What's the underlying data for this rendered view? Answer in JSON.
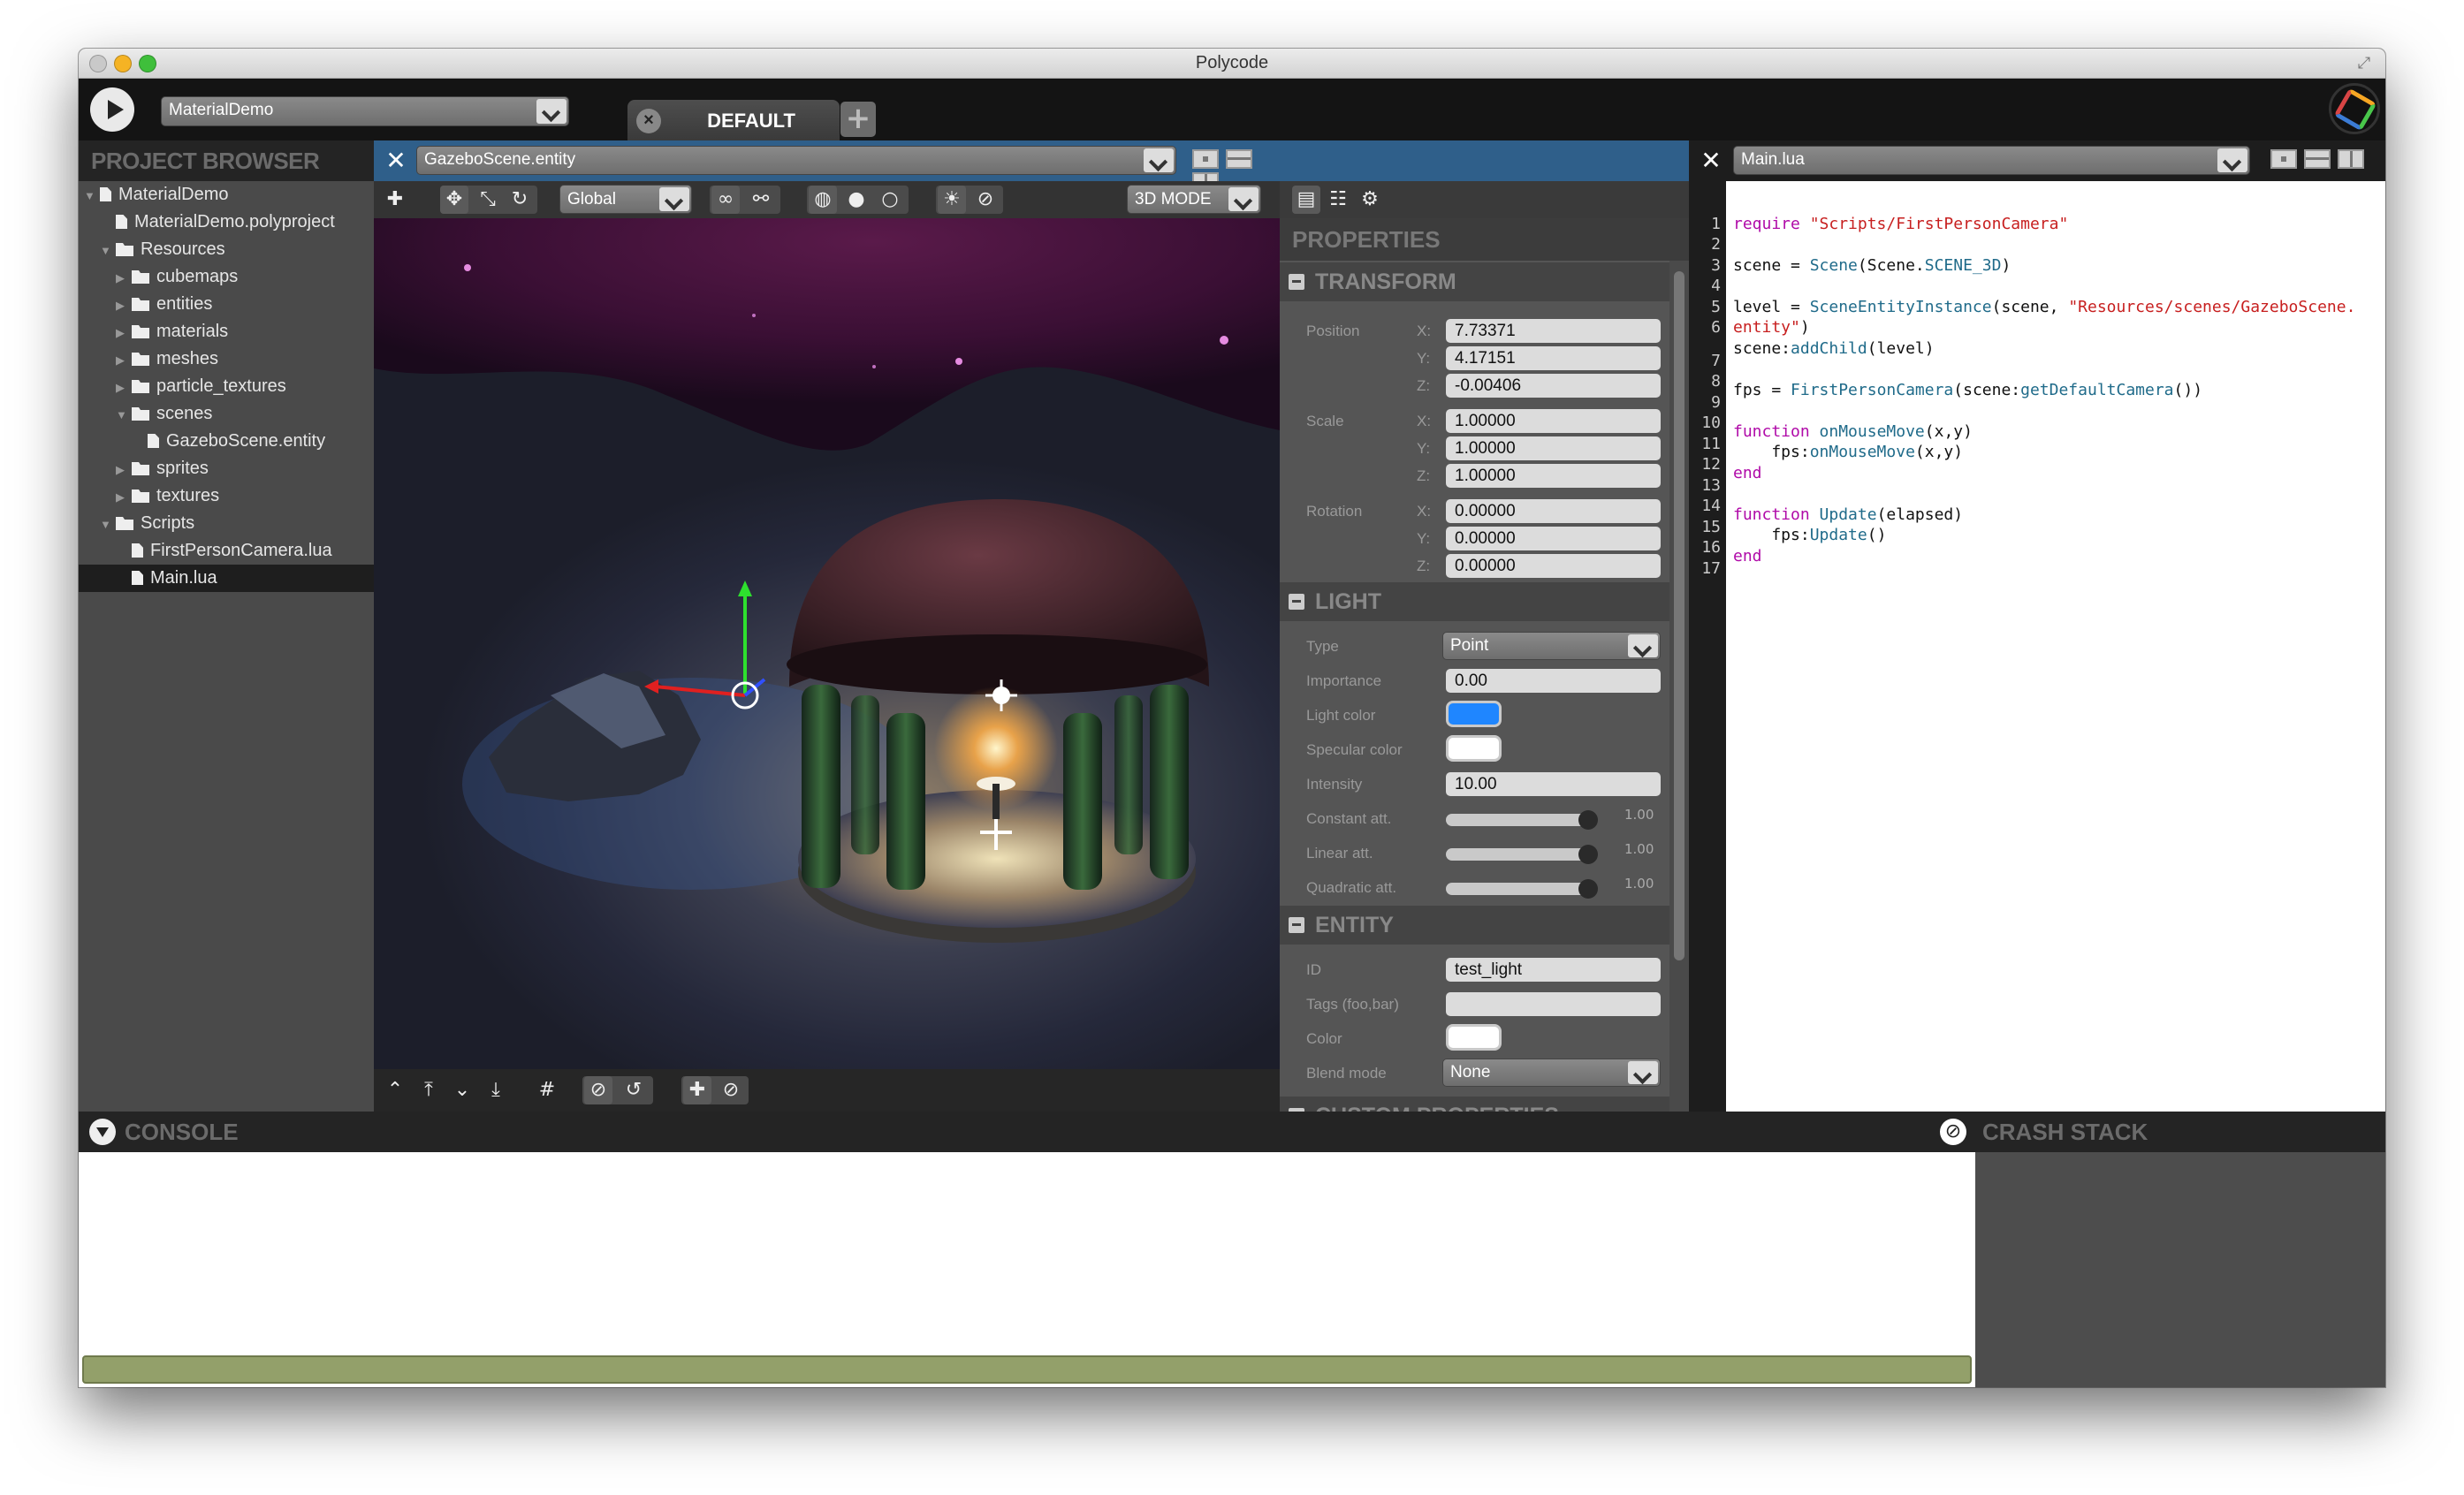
{
  "window": {
    "title": "Polycode"
  },
  "topbar": {
    "project_selected": "MaterialDemo",
    "tab_label": "DEFAULT"
  },
  "project_browser": {
    "title": "PROJECT BROWSER",
    "items": [
      {
        "label": "MaterialDemo",
        "icon": "project-icon",
        "depth": 0,
        "expanded": true
      },
      {
        "label": "MaterialDemo.polyproject",
        "icon": "file-icon",
        "depth": 1
      },
      {
        "label": "Resources",
        "icon": "folder-icon",
        "depth": 1,
        "expanded": true
      },
      {
        "label": "cubemaps",
        "icon": "folder-icon",
        "depth": 2
      },
      {
        "label": "entities",
        "icon": "folder-icon",
        "depth": 2
      },
      {
        "label": "materials",
        "icon": "folder-icon",
        "depth": 2
      },
      {
        "label": "meshes",
        "icon": "folder-icon",
        "depth": 2
      },
      {
        "label": "particle_textures",
        "icon": "folder-icon",
        "depth": 2
      },
      {
        "label": "scenes",
        "icon": "folder-icon",
        "depth": 2,
        "expanded": true
      },
      {
        "label": "GazeboScene.entity",
        "icon": "file-icon",
        "depth": 3
      },
      {
        "label": "sprites",
        "icon": "folder-icon",
        "depth": 2
      },
      {
        "label": "textures",
        "icon": "folder-icon",
        "depth": 2
      },
      {
        "label": "Scripts",
        "icon": "folder-icon",
        "depth": 1,
        "expanded": true
      },
      {
        "label": "FirstPersonCamera.lua",
        "icon": "file-icon",
        "depth": 2
      },
      {
        "label": "Main.lua",
        "icon": "file-icon",
        "depth": 2,
        "selected": true
      }
    ]
  },
  "entity_editor": {
    "file": "GazeboScene.entity",
    "space_dropdown": "Global",
    "mode_dropdown": "3D MODE"
  },
  "properties": {
    "title": "PROPERTIES",
    "transform": {
      "title": "TRANSFORM",
      "position_label": "Position",
      "scale_label": "Scale",
      "rotation_label": "Rotation",
      "x": "X:",
      "y": "Y:",
      "z": "Z:",
      "position": [
        "7.73371",
        "4.17151",
        "-0.00406"
      ],
      "scale": [
        "1.00000",
        "1.00000",
        "1.00000"
      ],
      "rotation": [
        "0.00000",
        "0.00000",
        "0.00000"
      ]
    },
    "light": {
      "title": "LIGHT",
      "type_label": "Type",
      "type_value": "Point",
      "importance_label": "Importance",
      "importance_value": "0.00",
      "light_color_label": "Light color",
      "light_color": "#1f86ff",
      "specular_color_label": "Specular color",
      "specular_color": "#ffffff",
      "intensity_label": "Intensity",
      "intensity_value": "10.00",
      "constant_label": "Constant att.",
      "constant_value": "1.00",
      "linear_label": "Linear att.",
      "linear_value": "1.00",
      "quadratic_label": "Quadratic att.",
      "quadratic_value": "1.00"
    },
    "entity": {
      "title": "ENTITY",
      "id_label": "ID",
      "id_value": "test_light",
      "tags_label": "Tags (foo,bar)",
      "tags_value": "",
      "color_label": "Color",
      "color_value": "#ffffff",
      "blend_label": "Blend mode",
      "blend_value": "None"
    },
    "custom": {
      "title": "CUSTOM PROPERTIES"
    }
  },
  "code_editor": {
    "file": "Main.lua",
    "line_numbers": [
      "1",
      "2",
      "3",
      "4",
      "5",
      "6",
      "7",
      "8",
      "9",
      "10",
      "11",
      "12",
      "13",
      "14",
      "15",
      "16",
      "17"
    ]
  },
  "console": {
    "title": "CONSOLE"
  },
  "crash_stack": {
    "title": "CRASH STACK"
  }
}
